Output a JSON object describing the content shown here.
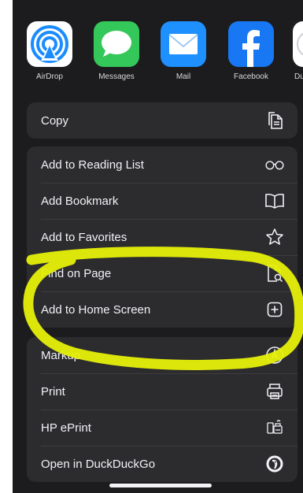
{
  "apps": [
    {
      "name": "AirDrop",
      "icon": "airdrop-icon"
    },
    {
      "name": "Messages",
      "icon": "messages-icon"
    },
    {
      "name": "Mail",
      "icon": "mail-icon"
    },
    {
      "name": "Facebook",
      "icon": "facebook-icon"
    },
    {
      "name": "Du",
      "icon": "duckduckgo-app-icon"
    }
  ],
  "groups": [
    [
      {
        "label": "Copy",
        "icon": "copy-icon"
      }
    ],
    [
      {
        "label": "Add to Reading List",
        "icon": "glasses-icon"
      },
      {
        "label": "Add Bookmark",
        "icon": "book-icon"
      },
      {
        "label": "Add to Favorites",
        "icon": "star-icon"
      },
      {
        "label": "Find on Page",
        "icon": "find-on-page-icon"
      },
      {
        "label": "Add to Home Screen",
        "icon": "plus-square-icon"
      }
    ],
    [
      {
        "label": "Markup",
        "icon": "markup-icon"
      },
      {
        "label": "Print",
        "icon": "printer-icon"
      },
      {
        "label": "HP ePrint",
        "icon": "hp-eprint-icon"
      },
      {
        "label": "Open in DuckDuckGo",
        "icon": "duckduckgo-icon"
      }
    ]
  ],
  "colors": {
    "sheet_background": "#1c1c1e",
    "row_background": "#2c2c2e",
    "annotation_highlight": "#e6f00a"
  }
}
